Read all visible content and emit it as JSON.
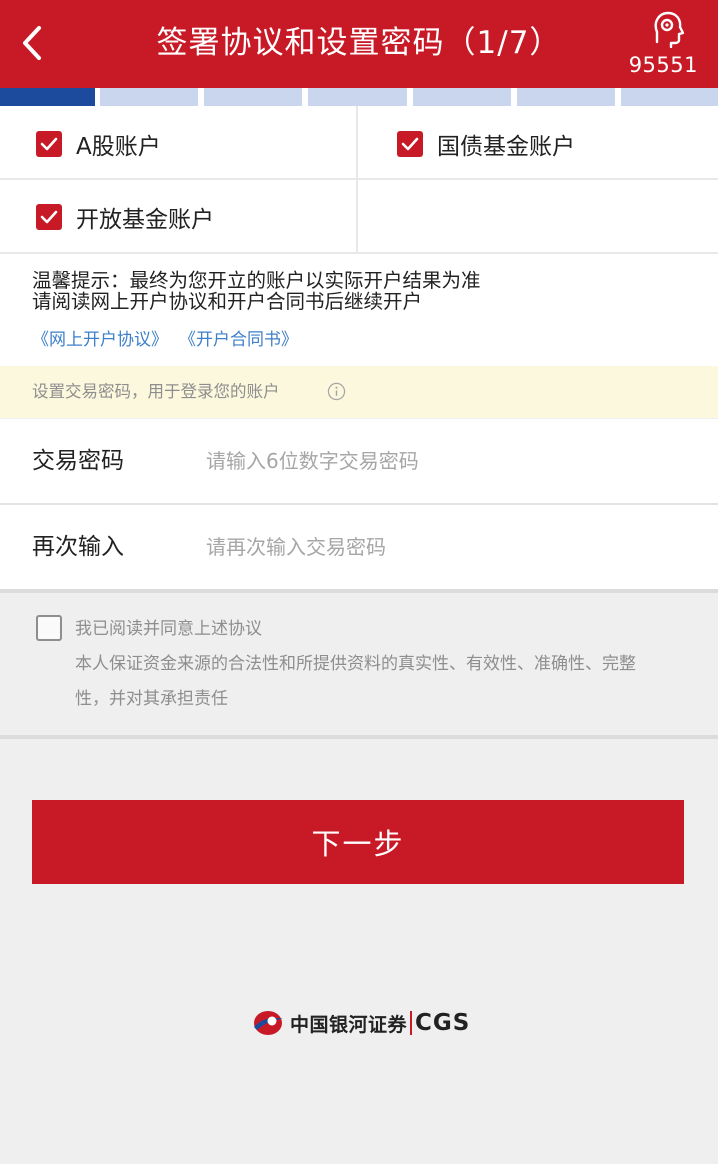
{
  "header": {
    "title": "签署协议和设置密码（1/7）",
    "service_phone": "95551",
    "back_icon": "chevron-left-icon",
    "service_icon": "customer-service-icon"
  },
  "progress": {
    "current_step": 1,
    "total_steps": 7
  },
  "accounts": [
    {
      "label": "A股账户",
      "checked": true
    },
    {
      "label": "国债基金账户",
      "checked": true
    },
    {
      "label": "开放基金账户",
      "checked": true
    }
  ],
  "notice": {
    "line1": "温馨提示：最终为您开立的账户以实际开户结果为准",
    "line2": "请阅读网上开户协议和开户合同书后继续开户",
    "links": [
      "《网上开户协议》",
      "《开户合同书》"
    ]
  },
  "password_tip": "设置交易密码，用于登录您的账户",
  "fields": {
    "password": {
      "label": "交易密码",
      "placeholder": "请输入6位数字交易密码",
      "value": ""
    },
    "confirm": {
      "label": "再次输入",
      "placeholder": "请再次输入交易密码",
      "value": ""
    }
  },
  "agreement": {
    "label": "我已阅读并同意上述协议",
    "desc_line1": "本人保证资金来源的合法性和所提供资料的真实性、有效性、准确性、完整",
    "desc_line2": "性，并对其承担责任",
    "checked": false
  },
  "next_button": "下一步",
  "footer": {
    "logo_cn": "中国银河证券",
    "logo_en": "CGS"
  },
  "colors": {
    "brand_red": "#c81a26",
    "step_active": "#1c4a9c",
    "step_inactive": "#c9d6ee",
    "link_blue": "#3d7fc9",
    "tip_bg": "#fbf8dd"
  }
}
